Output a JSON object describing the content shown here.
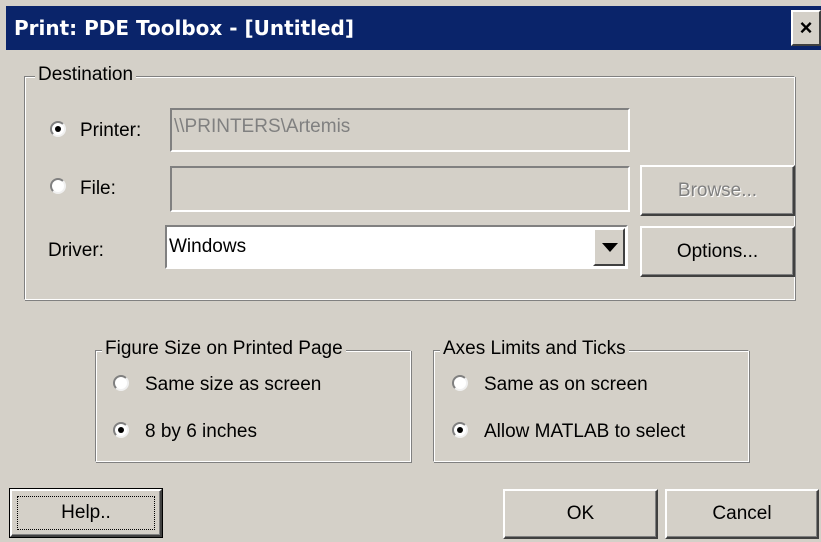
{
  "window": {
    "title": "Print: PDE Toolbox - [Untitled]",
    "close_glyph": "×"
  },
  "destination": {
    "legend": "Destination",
    "printer": {
      "label": "Printer:",
      "selected": true,
      "value": "\\\\PRINTERS\\Artemis"
    },
    "file": {
      "label": "File:",
      "selected": false,
      "value": ""
    },
    "browse_label": "Browse...",
    "driver": {
      "label": "Driver:",
      "value": "Windows"
    },
    "options_label": "Options..."
  },
  "figure_size": {
    "legend": "Figure Size on Printed Page",
    "options": [
      {
        "label": "Same size as screen",
        "selected": false
      },
      {
        "label": "8 by 6 inches",
        "selected": true
      }
    ]
  },
  "axes_limits": {
    "legend": "Axes Limits and Ticks",
    "options": [
      {
        "label": "Same as on screen",
        "selected": false
      },
      {
        "label": "Allow MATLAB to select",
        "selected": true
      }
    ]
  },
  "buttons": {
    "help": "Help..",
    "ok": "OK",
    "cancel": "Cancel"
  },
  "colors": {
    "titlebar": "#0a246a",
    "face": "#d4d0c8"
  }
}
